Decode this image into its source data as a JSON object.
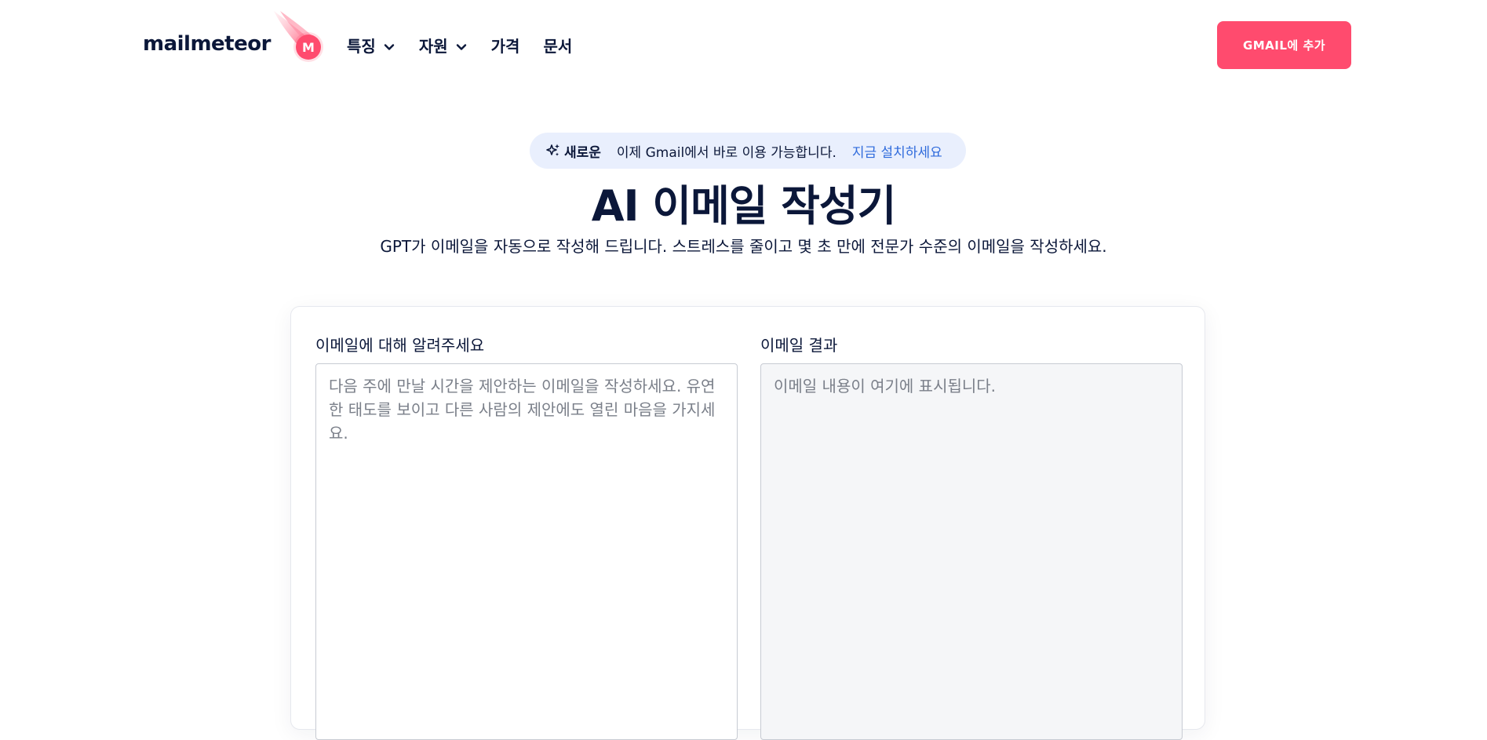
{
  "header": {
    "logo_text": "mailmeteor",
    "logo_mark_letter": "M",
    "nav": [
      {
        "label": "특징",
        "has_dropdown": true
      },
      {
        "label": "자원",
        "has_dropdown": true
      },
      {
        "label": "가격",
        "has_dropdown": false
      },
      {
        "label": "문서",
        "has_dropdown": false
      }
    ],
    "cta_label": "GMAIL에 추가"
  },
  "announcement": {
    "tag": "새로운",
    "message": "이제 Gmail에서 바로 이용 가능합니다.",
    "link": "지금 설치하세요"
  },
  "hero": {
    "title": "AI 이메일 작성기",
    "subtitle": "GPT가 이메일을 자동으로 작성해 드립니다. 스트레스를 줄이고 몇 초 만에 전문가 수준의 이메일을 작성하세요."
  },
  "composer": {
    "input_label": "이메일에 대해 알려주세요",
    "input_placeholder": "다음 주에 만날 시간을 제안하는 이메일을 작성하세요. 유연한 태도를 보이고 다른 사람의 제안에도 열린 마음을 가지세요.",
    "input_value": "",
    "result_label": "이메일 결과",
    "result_placeholder": "이메일 내용이 여기에 표시됩니다."
  },
  "colors": {
    "brand": "#ff4b6e",
    "text": "#0b1739",
    "link": "#2f6bdc",
    "pill_bg": "#e9effd"
  },
  "icons": {
    "logo": "meteor-logo-icon",
    "dropdown": "chevron-down-icon",
    "sparkle": "sparkle-icon"
  }
}
